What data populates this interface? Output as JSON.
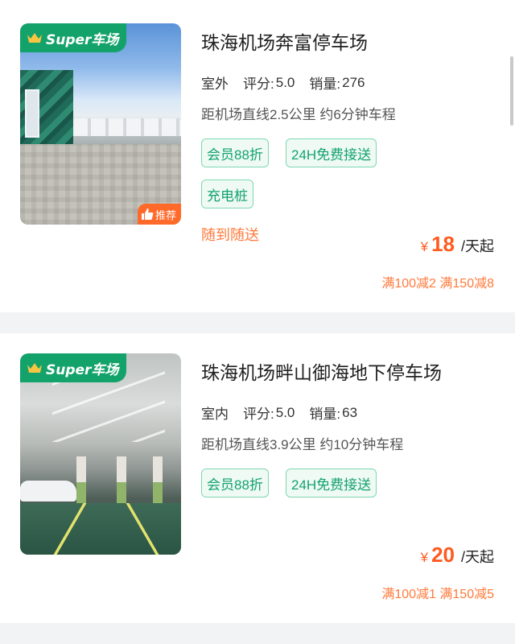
{
  "badges": {
    "super": "Super车场",
    "recommend": "推荐"
  },
  "lots": [
    {
      "name": "珠海机场奔富停车场",
      "type": "室外",
      "rating_label": "评分:",
      "rating": "5.0",
      "sales_label": "销量:",
      "sales": "276",
      "distance": "距机场直线2.5公里 约6分钟车程",
      "tags": [
        "会员88折",
        "24H免费接送",
        "充电桩"
      ],
      "service": "随到随送",
      "currency": "¥",
      "price": "18",
      "price_unit": "/天起",
      "promo": "满100减2 满150减8",
      "recommended": true
    },
    {
      "name": "珠海机场畔山御海地下停车场",
      "type": "室内",
      "rating_label": "评分:",
      "rating": "5.0",
      "sales_label": "销量:",
      "sales": "63",
      "distance": "距机场直线3.9公里 约10分钟车程",
      "tags": [
        "会员88折",
        "24H免费接送"
      ],
      "currency": "¥",
      "price": "20",
      "price_unit": "/天起",
      "promo": "满100减1 满150减5",
      "recommended": false
    }
  ],
  "colors": {
    "green": "#12a26a",
    "orange": "#ff5a1f",
    "tag_bg": "#effaf5"
  }
}
